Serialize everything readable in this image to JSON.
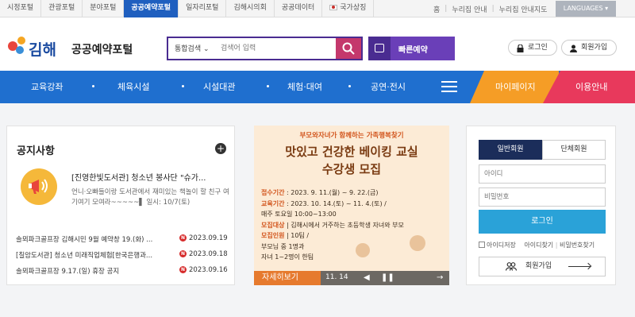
{
  "topbar": {
    "portals": [
      "시정포털",
      "관광포털",
      "분야포털",
      "공공예약포털",
      "일자리포털",
      "김해시의회",
      "공공데이터",
      "국가상징"
    ],
    "active_portal": "공공예약포털",
    "util_links": [
      "홈",
      "누리집 안내",
      "누리집 안내지도"
    ],
    "language_label": "LANGUAGES"
  },
  "header": {
    "logo_text": "김해",
    "site_title": "공공예약포털",
    "search_scope": "통합검색",
    "search_placeholder": "검색어 입력",
    "quick_reserve_label": "빠른예약",
    "login_label": "로그인",
    "signup_label": "회원가입"
  },
  "gnb": {
    "items": [
      "교육강좌",
      "체육시설",
      "시설대관",
      "체험·대여",
      "공연·전시"
    ],
    "mypage_label": "마이페이지",
    "usage_label": "이용안내"
  },
  "notice": {
    "title": "공지사항",
    "featured_title": "[진영한빛도서관] 청소년 봉사단 \"슈가...",
    "featured_body": "언니·오빠들이랑 도서관에서 재미있는 책놀이 할 친구 여기여기 모여라~~~~~▌ 일시: 10/7(토)",
    "new_badge": "N",
    "items": [
      {
        "text": "솔뫼파크골프장 김해시민 9월 예약창 19.(화) ...",
        "date": "2023.09.19"
      },
      {
        "text": "[칠암도서관] 청소년 미래직업체험[한국은행과...",
        "date": "2023.09.18"
      },
      {
        "text": "솔뫼파크골프장 9.17.(일) 휴장 공지",
        "date": "2023.09.16"
      }
    ]
  },
  "banner": {
    "top_line": "부모와자녀가 함께하는 가족행복찾기",
    "headline_1": "맛있고 건강한 베이킹 교실",
    "headline_2": "수강생 모집",
    "info": [
      {
        "label": "접수기간",
        "value": " : 2023. 9. 11.(월) ~ 9. 22.(금)"
      },
      {
        "label": "교육기간",
        "value": " : 2023. 10. 14.(토) ~ 11. 4.(토) /"
      },
      {
        "label": "",
        "value": "매주 토요일 10:00~13:00"
      },
      {
        "label": "모집대상",
        "value": " | 김해시에서 거주하는 초등학생 자녀와 부모"
      },
      {
        "label": "모집인원",
        "value": " | 10팀 /"
      },
      {
        "label": "",
        "value": "부모님 중 1명과"
      },
      {
        "label": "",
        "value": "자녀 1~2명이 한팀"
      }
    ],
    "more_label": "자세히보기",
    "counter": "11. 14"
  },
  "login": {
    "tab_member": "일반회원",
    "tab_group": "단체회원",
    "id_placeholder": "아이디",
    "pw_placeholder": "비밀번호",
    "login_button": "로그인",
    "save_id": "아이디저장",
    "find_id": "아이디찾기",
    "find_pw": "비밀번호찾기",
    "join_label": "회원가입"
  },
  "colors": {
    "gnb_blue": "#1f6fcf",
    "search_purple": "#4a2c91",
    "search_pink": "#c4386c",
    "mypage_orange": "#f59d26",
    "usage_pink": "#e8395c",
    "login_blue": "#2aa2d8",
    "tab_navy": "#1b2d5a"
  }
}
